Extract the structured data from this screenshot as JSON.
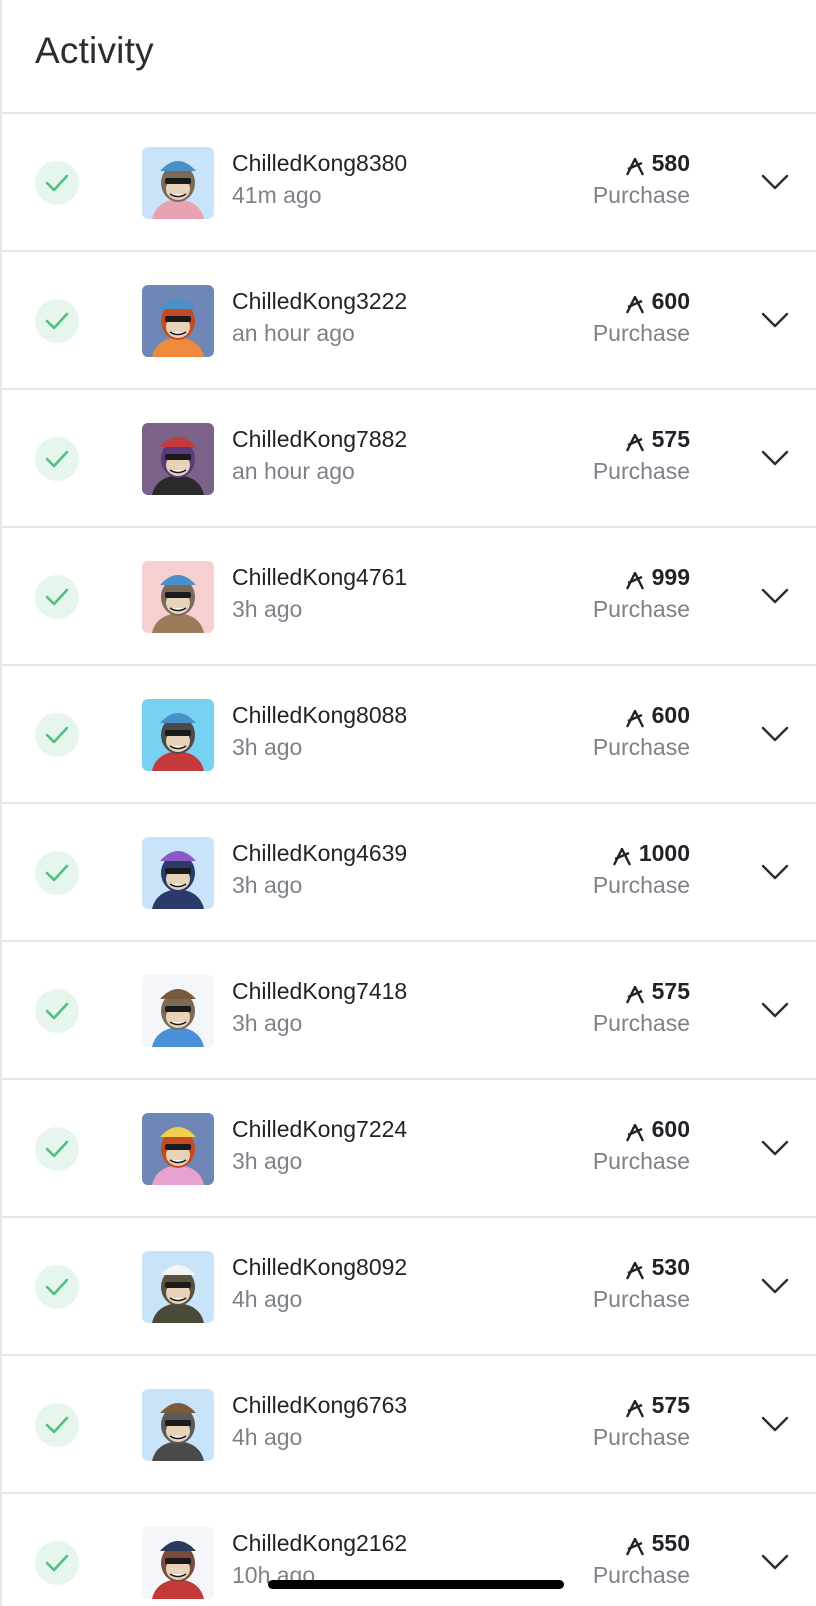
{
  "header": {
    "title": "Activity"
  },
  "colors": {
    "status_bg": "#e7f6ed",
    "status_check": "#4cc27f",
    "divider": "#e4e6e9",
    "muted_text": "#7d8289"
  },
  "icons": {
    "status": "check-icon",
    "currency": "algo-icon",
    "expand": "chevron-down-icon"
  },
  "activity": [
    {
      "name": "ChilledKong8380",
      "time": "41m ago",
      "price": "580",
      "kind": "Purchase",
      "bg": "#c9e4f8",
      "hat": "#4a90c8",
      "fur": "#7b6a5a",
      "shirt": "#e9a2b1"
    },
    {
      "name": "ChilledKong3222",
      "time": "an hour ago",
      "price": "600",
      "kind": "Purchase",
      "bg": "#6f87b6",
      "hat": "#4a90c8",
      "fur": "#c24a24",
      "shirt": "#ef8a3c"
    },
    {
      "name": "ChilledKong7882",
      "time": "an hour ago",
      "price": "575",
      "kind": "Purchase",
      "bg": "#7b6288",
      "hat": "#c43a3a",
      "fur": "#5a3a7a",
      "shirt": "#2a2a2a"
    },
    {
      "name": "ChilledKong4761",
      "time": "3h ago",
      "price": "999",
      "kind": "Purchase",
      "bg": "#f6cfd0",
      "hat": "#4a90c8",
      "fur": "#7b6a5a",
      "shirt": "#9c7a5a"
    },
    {
      "name": "ChilledKong8088",
      "time": "3h ago",
      "price": "600",
      "kind": "Purchase",
      "bg": "#76d2f0",
      "hat": "#4a90c8",
      "fur": "#4a4a4a",
      "shirt": "#c43a3a"
    },
    {
      "name": "ChilledKong4639",
      "time": "3h ago",
      "price": "1000",
      "kind": "Purchase",
      "bg": "#c9e4f8",
      "hat": "#8a5ac8",
      "fur": "#2a3a6a",
      "shirt": "#2a3a6a"
    },
    {
      "name": "ChilledKong7418",
      "time": "3h ago",
      "price": "575",
      "kind": "Purchase",
      "bg": "#f4f6fa",
      "hat": "#7a5a3a",
      "fur": "#7b6a5a",
      "shirt": "#4a90d8"
    },
    {
      "name": "ChilledKong7224",
      "time": "3h ago",
      "price": "600",
      "kind": "Purchase",
      "bg": "#6f87b6",
      "hat": "#f2d04a",
      "fur": "#c24a24",
      "shirt": "#e9a2d0"
    },
    {
      "name": "ChilledKong8092",
      "time": "4h ago",
      "price": "530",
      "kind": "Purchase",
      "bg": "#c9e4f8",
      "hat": "#f4f4f4",
      "fur": "#5a5040",
      "shirt": "#4a4a3a"
    },
    {
      "name": "ChilledKong6763",
      "time": "4h ago",
      "price": "575",
      "kind": "Purchase",
      "bg": "#c9e4f8",
      "hat": "#7a5a3a",
      "fur": "#5a5a5a",
      "shirt": "#4a4a4a"
    },
    {
      "name": "ChilledKong2162",
      "time": "10h ago",
      "price": "550",
      "kind": "Purchase",
      "bg": "#f4f6fa",
      "hat": "#2a3a5a",
      "fur": "#7b4a3a",
      "shirt": "#c43a3a"
    }
  ]
}
